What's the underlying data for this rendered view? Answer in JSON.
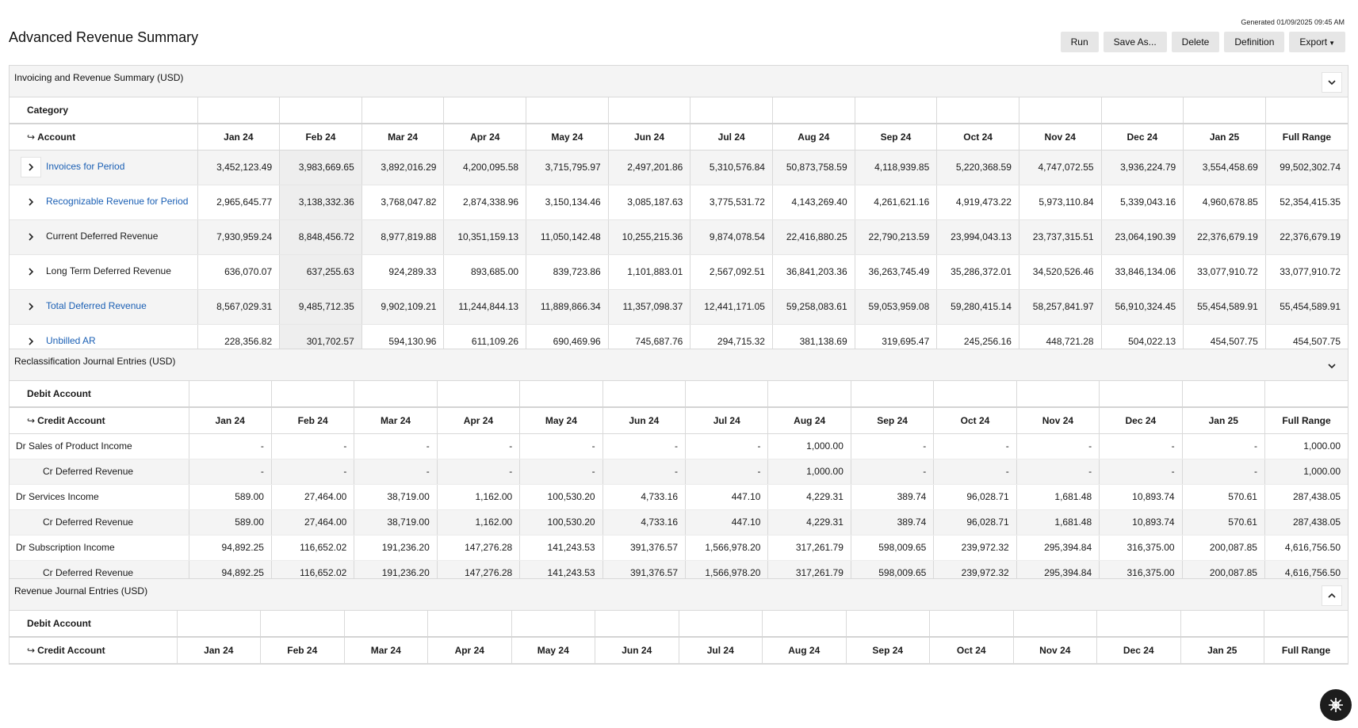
{
  "header": {
    "generated": "Generated 01/09/2025 09:45 AM",
    "title": "Advanced Revenue Summary"
  },
  "toolbar": {
    "run": "Run",
    "save_as": "Save As...",
    "delete": "Delete",
    "definition": "Definition",
    "export": "Export"
  },
  "months": [
    "Jan 24",
    "Feb 24",
    "Mar 24",
    "Apr 24",
    "May 24",
    "Jun 24",
    "Jul 24",
    "Aug 24",
    "Sep 24",
    "Oct 24",
    "Nov 24",
    "Dec 24",
    "Jan 25",
    "Full Range"
  ],
  "summary": {
    "title": "Invoicing and Revenue Summary (USD)",
    "header_top": "Category",
    "header_sub": "Account",
    "rows": [
      {
        "name": "Invoices for Period",
        "link": true,
        "values": [
          "3,452,123.49",
          "3,983,669.65",
          "3,892,016.29",
          "4,200,095.58",
          "3,715,795.97",
          "2,497,201.86",
          "5,310,576.84",
          "50,873,758.59",
          "4,118,939.85",
          "5,220,368.59",
          "4,747,072.55",
          "3,936,224.79",
          "3,554,458.69",
          "99,502,302.74"
        ]
      },
      {
        "name": "Recognizable Revenue for Period",
        "link": true,
        "values": [
          "2,965,645.77",
          "3,138,332.36",
          "3,768,047.82",
          "2,874,338.96",
          "3,150,134.46",
          "3,085,187.63",
          "3,775,531.72",
          "4,143,269.40",
          "4,261,621.16",
          "4,919,473.22",
          "5,973,110.84",
          "5,339,043.16",
          "4,960,678.85",
          "52,354,415.35"
        ]
      },
      {
        "name": "Current Deferred Revenue",
        "link": false,
        "values": [
          "7,930,959.24",
          "8,848,456.72",
          "8,977,819.88",
          "10,351,159.13",
          "11,050,142.48",
          "10,255,215.36",
          "9,874,078.54",
          "22,416,880.25",
          "22,790,213.59",
          "23,994,043.13",
          "23,737,315.51",
          "23,064,190.39",
          "22,376,679.19",
          "22,376,679.19"
        ]
      },
      {
        "name": "Long Term Deferred Revenue",
        "link": false,
        "values": [
          "636,070.07",
          "637,255.63",
          "924,289.33",
          "893,685.00",
          "839,723.86",
          "1,101,883.01",
          "2,567,092.51",
          "36,841,203.36",
          "36,263,745.49",
          "35,286,372.01",
          "34,520,526.46",
          "33,846,134.06",
          "33,077,910.72",
          "33,077,910.72"
        ]
      },
      {
        "name": "Total Deferred Revenue",
        "link": true,
        "values": [
          "8,567,029.31",
          "9,485,712.35",
          "9,902,109.21",
          "11,244,844.13",
          "11,889,866.34",
          "11,357,098.37",
          "12,441,171.05",
          "59,258,083.61",
          "59,053,959.08",
          "59,280,415.14",
          "58,257,841.97",
          "56,910,324.45",
          "55,454,589.91",
          "55,454,589.91"
        ]
      },
      {
        "name": "Unbilled AR",
        "link": true,
        "values": [
          "228,356.82",
          "301,702.57",
          "594,130.96",
          "611,109.26",
          "690,469.96",
          "745,687.76",
          "294,715.32",
          "381,138.69",
          "319,695.47",
          "245,256.16",
          "448,721.28",
          "504,022.13",
          "454,507.75",
          "454,507.75"
        ]
      }
    ]
  },
  "reclass": {
    "title": "Reclassification Journal Entries (USD)",
    "header_top": "Debit Account",
    "header_sub": "Credit Account",
    "rows": [
      {
        "name": "Dr Sales of Product Income",
        "sub": false,
        "values": [
          "-",
          "-",
          "-",
          "-",
          "-",
          "-",
          "-",
          "1,000.00",
          "-",
          "-",
          "-",
          "-",
          "-",
          "1,000.00"
        ]
      },
      {
        "name": "Cr Deferred Revenue",
        "sub": true,
        "values": [
          "-",
          "-",
          "-",
          "-",
          "-",
          "-",
          "-",
          "1,000.00",
          "-",
          "-",
          "-",
          "-",
          "-",
          "1,000.00"
        ]
      },
      {
        "name": "Dr Services Income",
        "sub": false,
        "values": [
          "589.00",
          "27,464.00",
          "38,719.00",
          "1,162.00",
          "100,530.20",
          "4,733.16",
          "447.10",
          "4,229.31",
          "389.74",
          "96,028.71",
          "1,681.48",
          "10,893.74",
          "570.61",
          "287,438.05"
        ]
      },
      {
        "name": "Cr Deferred Revenue",
        "sub": true,
        "values": [
          "589.00",
          "27,464.00",
          "38,719.00",
          "1,162.00",
          "100,530.20",
          "4,733.16",
          "447.10",
          "4,229.31",
          "389.74",
          "96,028.71",
          "1,681.48",
          "10,893.74",
          "570.61",
          "287,438.05"
        ]
      },
      {
        "name": "Dr Subscription Income",
        "sub": false,
        "values": [
          "94,892.25",
          "116,652.02",
          "191,236.20",
          "147,276.28",
          "141,243.53",
          "391,376.57",
          "1,566,978.20",
          "317,261.79",
          "598,009.65",
          "239,972.32",
          "295,394.84",
          "316,375.00",
          "200,087.85",
          "4,616,756.50"
        ]
      },
      {
        "name": "Cr Deferred Revenue",
        "sub": true,
        "values": [
          "94,892.25",
          "116,652.02",
          "191,236.20",
          "147,276.28",
          "141,243.53",
          "391,376.57",
          "1,566,978.20",
          "317,261.79",
          "598,009.65",
          "239,972.32",
          "295,394.84",
          "316,375.00",
          "200,087.85",
          "4,616,756.50"
        ]
      }
    ]
  },
  "revenue": {
    "title": "Revenue Journal Entries (USD)",
    "header_top": "Debit Account",
    "header_sub": "Credit Account"
  },
  "colors": {
    "link": "#1a5fb4",
    "panel_header": "#f4f4f4",
    "button": "#e6e6e6"
  }
}
